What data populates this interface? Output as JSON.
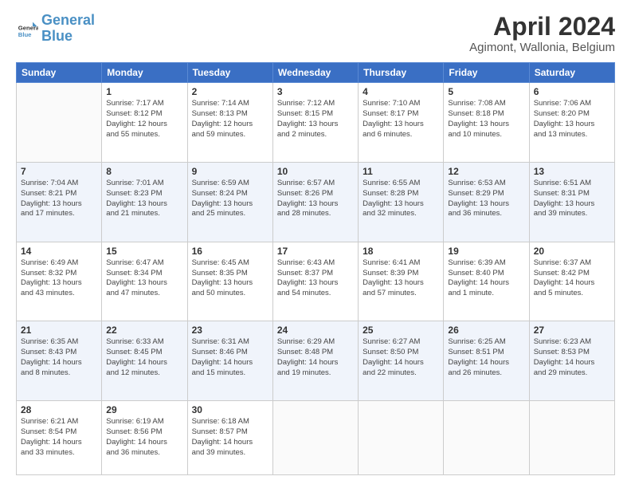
{
  "logo": {
    "line1": "General",
    "line2": "Blue"
  },
  "title": "April 2024",
  "subtitle": "Agimont, Wallonia, Belgium",
  "calendar": {
    "headers": [
      "Sunday",
      "Monday",
      "Tuesday",
      "Wednesday",
      "Thursday",
      "Friday",
      "Saturday"
    ],
    "weeks": [
      [
        {
          "day": "",
          "info": ""
        },
        {
          "day": "1",
          "info": "Sunrise: 7:17 AM\nSunset: 8:12 PM\nDaylight: 12 hours\nand 55 minutes."
        },
        {
          "day": "2",
          "info": "Sunrise: 7:14 AM\nSunset: 8:13 PM\nDaylight: 12 hours\nand 59 minutes."
        },
        {
          "day": "3",
          "info": "Sunrise: 7:12 AM\nSunset: 8:15 PM\nDaylight: 13 hours\nand 2 minutes."
        },
        {
          "day": "4",
          "info": "Sunrise: 7:10 AM\nSunset: 8:17 PM\nDaylight: 13 hours\nand 6 minutes."
        },
        {
          "day": "5",
          "info": "Sunrise: 7:08 AM\nSunset: 8:18 PM\nDaylight: 13 hours\nand 10 minutes."
        },
        {
          "day": "6",
          "info": "Sunrise: 7:06 AM\nSunset: 8:20 PM\nDaylight: 13 hours\nand 13 minutes."
        }
      ],
      [
        {
          "day": "7",
          "info": "Sunrise: 7:04 AM\nSunset: 8:21 PM\nDaylight: 13 hours\nand 17 minutes."
        },
        {
          "day": "8",
          "info": "Sunrise: 7:01 AM\nSunset: 8:23 PM\nDaylight: 13 hours\nand 21 minutes."
        },
        {
          "day": "9",
          "info": "Sunrise: 6:59 AM\nSunset: 8:24 PM\nDaylight: 13 hours\nand 25 minutes."
        },
        {
          "day": "10",
          "info": "Sunrise: 6:57 AM\nSunset: 8:26 PM\nDaylight: 13 hours\nand 28 minutes."
        },
        {
          "day": "11",
          "info": "Sunrise: 6:55 AM\nSunset: 8:28 PM\nDaylight: 13 hours\nand 32 minutes."
        },
        {
          "day": "12",
          "info": "Sunrise: 6:53 AM\nSunset: 8:29 PM\nDaylight: 13 hours\nand 36 minutes."
        },
        {
          "day": "13",
          "info": "Sunrise: 6:51 AM\nSunset: 8:31 PM\nDaylight: 13 hours\nand 39 minutes."
        }
      ],
      [
        {
          "day": "14",
          "info": "Sunrise: 6:49 AM\nSunset: 8:32 PM\nDaylight: 13 hours\nand 43 minutes."
        },
        {
          "day": "15",
          "info": "Sunrise: 6:47 AM\nSunset: 8:34 PM\nDaylight: 13 hours\nand 47 minutes."
        },
        {
          "day": "16",
          "info": "Sunrise: 6:45 AM\nSunset: 8:35 PM\nDaylight: 13 hours\nand 50 minutes."
        },
        {
          "day": "17",
          "info": "Sunrise: 6:43 AM\nSunset: 8:37 PM\nDaylight: 13 hours\nand 54 minutes."
        },
        {
          "day": "18",
          "info": "Sunrise: 6:41 AM\nSunset: 8:39 PM\nDaylight: 13 hours\nand 57 minutes."
        },
        {
          "day": "19",
          "info": "Sunrise: 6:39 AM\nSunset: 8:40 PM\nDaylight: 14 hours\nand 1 minute."
        },
        {
          "day": "20",
          "info": "Sunrise: 6:37 AM\nSunset: 8:42 PM\nDaylight: 14 hours\nand 5 minutes."
        }
      ],
      [
        {
          "day": "21",
          "info": "Sunrise: 6:35 AM\nSunset: 8:43 PM\nDaylight: 14 hours\nand 8 minutes."
        },
        {
          "day": "22",
          "info": "Sunrise: 6:33 AM\nSunset: 8:45 PM\nDaylight: 14 hours\nand 12 minutes."
        },
        {
          "day": "23",
          "info": "Sunrise: 6:31 AM\nSunset: 8:46 PM\nDaylight: 14 hours\nand 15 minutes."
        },
        {
          "day": "24",
          "info": "Sunrise: 6:29 AM\nSunset: 8:48 PM\nDaylight: 14 hours\nand 19 minutes."
        },
        {
          "day": "25",
          "info": "Sunrise: 6:27 AM\nSunset: 8:50 PM\nDaylight: 14 hours\nand 22 minutes."
        },
        {
          "day": "26",
          "info": "Sunrise: 6:25 AM\nSunset: 8:51 PM\nDaylight: 14 hours\nand 26 minutes."
        },
        {
          "day": "27",
          "info": "Sunrise: 6:23 AM\nSunset: 8:53 PM\nDaylight: 14 hours\nand 29 minutes."
        }
      ],
      [
        {
          "day": "28",
          "info": "Sunrise: 6:21 AM\nSunset: 8:54 PM\nDaylight: 14 hours\nand 33 minutes."
        },
        {
          "day": "29",
          "info": "Sunrise: 6:19 AM\nSunset: 8:56 PM\nDaylight: 14 hours\nand 36 minutes."
        },
        {
          "day": "30",
          "info": "Sunrise: 6:18 AM\nSunset: 8:57 PM\nDaylight: 14 hours\nand 39 minutes."
        },
        {
          "day": "",
          "info": ""
        },
        {
          "day": "",
          "info": ""
        },
        {
          "day": "",
          "info": ""
        },
        {
          "day": "",
          "info": ""
        }
      ]
    ]
  }
}
